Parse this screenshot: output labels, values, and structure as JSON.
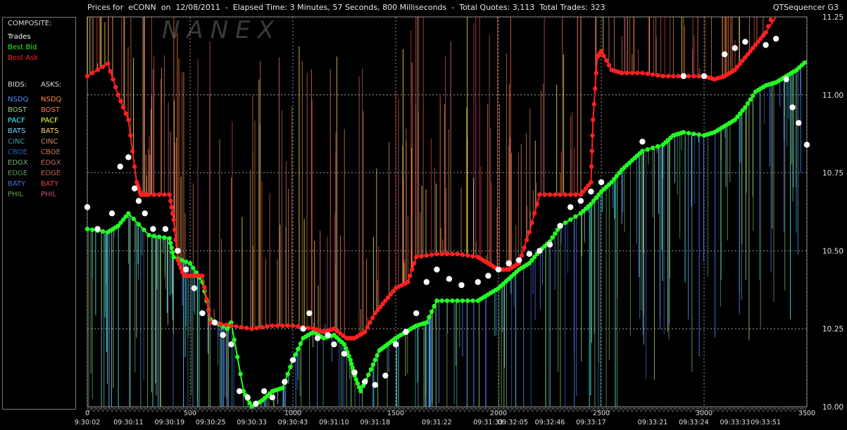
{
  "header": {
    "title": "Prices for  eCONN  on  12/08/2011  -  Elapsed Time: 3 Minutes, 57 Seconds, 800 Milliseconds  -  Total Quotes: 3,113  Total Trades: 323",
    "app_name": "QTSequencer G3",
    "watermark": "NANEX"
  },
  "sidebar": {
    "composite_label": "COMPOSITE:",
    "composite": [
      {
        "label": "Trades",
        "color": "#ffffff"
      },
      {
        "label": "Best Bid",
        "color": "#22ff22"
      },
      {
        "label": "Best Ask",
        "color": "#ff2020"
      }
    ],
    "bids_label": "BIDS:",
    "asks_label": "ASKS:",
    "exchanges": [
      {
        "bid": "NSDQ",
        "ask": "NSDQ",
        "bid_color": "#4f8fff",
        "ask_color": "#ff8a3a"
      },
      {
        "bid": "BOST",
        "ask": "BOST",
        "bid_color": "#a0d080",
        "ask_color": "#ff7a55"
      },
      {
        "bid": "PACF",
        "ask": "PACF",
        "bid_color": "#40ffff",
        "ask_color": "#ffff40"
      },
      {
        "bid": "BATS",
        "ask": "BATS",
        "bid_color": "#7fd0ff",
        "ask_color": "#ffd27a"
      },
      {
        "bid": "CINC",
        "ask": "CINC",
        "bid_color": "#3fa0a0",
        "ask_color": "#d08a6a"
      },
      {
        "bid": "CBOE",
        "ask": "CBOE",
        "bid_color": "#2a60c0",
        "ask_color": "#c87a40"
      },
      {
        "bid": "EDGX",
        "ask": "EDGX",
        "bid_color": "#70b070",
        "ask_color": "#c06a60"
      },
      {
        "bid": "EDGE",
        "ask": "EDGE",
        "bid_color": "#5a9a5a",
        "ask_color": "#c06050"
      },
      {
        "bid": "BATY",
        "ask": "BATY",
        "bid_color": "#4a70e0",
        "ask_color": "#e04040"
      },
      {
        "bid": "PHIL",
        "ask": "PHIL",
        "bid_color": "#70a050",
        "ask_color": "#c05070"
      }
    ]
  },
  "chart_data": {
    "type": "line",
    "xlim": [
      0,
      3500
    ],
    "ylim": [
      10.0,
      11.25
    ],
    "y_ticks": [
      "10.00",
      "10.25",
      "10.50",
      "10.75",
      "11.00",
      "11.25"
    ],
    "x_ticks": [
      "0",
      "500",
      "1000",
      "1500",
      "2000",
      "2500",
      "3000",
      "3500"
    ],
    "time_labels": [
      {
        "x": 0,
        "label": "9:30:02"
      },
      {
        "x": 200,
        "label": "09:30:11"
      },
      {
        "x": 400,
        "label": "09:30:19"
      },
      {
        "x": 600,
        "label": "09:30:25"
      },
      {
        "x": 800,
        "label": "09:30:33"
      },
      {
        "x": 1000,
        "label": "09:30:43"
      },
      {
        "x": 1200,
        "label": "09:31:10"
      },
      {
        "x": 1400,
        "label": "09:31:18"
      },
      {
        "x": 1700,
        "label": "09:31:22"
      },
      {
        "x": 1950,
        "label": "09:31:33"
      },
      {
        "x": 2070,
        "label": "09:32:05"
      },
      {
        "x": 2250,
        "label": "09:32:46"
      },
      {
        "x": 2450,
        "label": "09:33:17"
      },
      {
        "x": 2750,
        "label": "09:33:21"
      },
      {
        "x": 2950,
        "label": "09:33:24"
      },
      {
        "x": 3150,
        "label": "09:33:33"
      },
      {
        "x": 3300,
        "label": "09:33:51"
      }
    ],
    "grid": true,
    "series": [
      {
        "name": "Best Bid",
        "color": "#22ff22",
        "points": [
          [
            0,
            10.57
          ],
          [
            100,
            10.56
          ],
          [
            150,
            10.58
          ],
          [
            200,
            10.62
          ],
          [
            300,
            10.55
          ],
          [
            400,
            10.54
          ],
          [
            420,
            10.48
          ],
          [
            500,
            10.46
          ],
          [
            560,
            10.4
          ],
          [
            600,
            10.28
          ],
          [
            680,
            10.25
          ],
          [
            700,
            10.27
          ],
          [
            760,
            10.05
          ],
          [
            800,
            10.0
          ],
          [
            850,
            10.02
          ],
          [
            900,
            10.05
          ],
          [
            950,
            10.06
          ],
          [
            1000,
            10.15
          ],
          [
            1050,
            10.22
          ],
          [
            1100,
            10.24
          ],
          [
            1150,
            10.22
          ],
          [
            1200,
            10.23
          ],
          [
            1250,
            10.2
          ],
          [
            1280,
            10.15
          ],
          [
            1300,
            10.1
          ],
          [
            1330,
            10.05
          ],
          [
            1380,
            10.12
          ],
          [
            1420,
            10.18
          ],
          [
            1460,
            10.2
          ],
          [
            1500,
            10.22
          ],
          [
            1550,
            10.24
          ],
          [
            1600,
            10.26
          ],
          [
            1650,
            10.27
          ],
          [
            1700,
            10.34
          ],
          [
            1800,
            10.34
          ],
          [
            1900,
            10.34
          ],
          [
            1950,
            10.36
          ],
          [
            2000,
            10.38
          ],
          [
            2050,
            10.41
          ],
          [
            2100,
            10.44
          ],
          [
            2150,
            10.46
          ],
          [
            2200,
            10.5
          ],
          [
            2250,
            10.53
          ],
          [
            2300,
            10.58
          ],
          [
            2400,
            10.62
          ],
          [
            2450,
            10.65
          ],
          [
            2500,
            10.69
          ],
          [
            2550,
            10.72
          ],
          [
            2600,
            10.76
          ],
          [
            2650,
            10.79
          ],
          [
            2700,
            10.82
          ],
          [
            2800,
            10.84
          ],
          [
            2850,
            10.87
          ],
          [
            2900,
            10.88
          ],
          [
            3000,
            10.87
          ],
          [
            3050,
            10.88
          ],
          [
            3100,
            10.9
          ],
          [
            3150,
            10.92
          ],
          [
            3200,
            10.96
          ],
          [
            3250,
            11.01
          ],
          [
            3300,
            11.03
          ],
          [
            3350,
            11.04
          ],
          [
            3400,
            11.06
          ],
          [
            3450,
            11.08
          ],
          [
            3500,
            11.11
          ]
        ]
      },
      {
        "name": "Best Ask",
        "color": "#ff2020",
        "points": [
          [
            0,
            11.06
          ],
          [
            100,
            11.1
          ],
          [
            150,
            11.0
          ],
          [
            200,
            10.92
          ],
          [
            240,
            10.72
          ],
          [
            260,
            10.68
          ],
          [
            300,
            10.68
          ],
          [
            400,
            10.68
          ],
          [
            420,
            10.6
          ],
          [
            440,
            10.47
          ],
          [
            470,
            10.42
          ],
          [
            500,
            10.42
          ],
          [
            560,
            10.42
          ],
          [
            600,
            10.27
          ],
          [
            700,
            10.26
          ],
          [
            800,
            10.25
          ],
          [
            900,
            10.26
          ],
          [
            1000,
            10.26
          ],
          [
            1100,
            10.25
          ],
          [
            1150,
            10.24
          ],
          [
            1200,
            10.25
          ],
          [
            1260,
            10.22
          ],
          [
            1300,
            10.22
          ],
          [
            1350,
            10.24
          ],
          [
            1400,
            10.3
          ],
          [
            1450,
            10.34
          ],
          [
            1500,
            10.38
          ],
          [
            1560,
            10.4
          ],
          [
            1600,
            10.48
          ],
          [
            1700,
            10.49
          ],
          [
            1800,
            10.49
          ],
          [
            1900,
            10.48
          ],
          [
            1950,
            10.46
          ],
          [
            2000,
            10.44
          ],
          [
            2050,
            10.44
          ],
          [
            2100,
            10.46
          ],
          [
            2150,
            10.56
          ],
          [
            2200,
            10.68
          ],
          [
            2300,
            10.68
          ],
          [
            2400,
            10.68
          ],
          [
            2450,
            10.72
          ],
          [
            2460,
            10.92
          ],
          [
            2480,
            11.12
          ],
          [
            2500,
            11.14
          ],
          [
            2550,
            11.08
          ],
          [
            2600,
            11.07
          ],
          [
            2700,
            11.07
          ],
          [
            2800,
            11.06
          ],
          [
            2900,
            11.06
          ],
          [
            3000,
            11.06
          ],
          [
            3050,
            11.05
          ],
          [
            3100,
            11.06
          ],
          [
            3150,
            11.08
          ],
          [
            3200,
            11.12
          ],
          [
            3250,
            11.16
          ],
          [
            3300,
            11.2
          ],
          [
            3350,
            11.28
          ]
        ]
      }
    ],
    "trades": [
      [
        0,
        10.64
      ],
      [
        50,
        10.57
      ],
      [
        120,
        10.62
      ],
      [
        160,
        10.77
      ],
      [
        200,
        10.8
      ],
      [
        230,
        10.7
      ],
      [
        250,
        10.66
      ],
      [
        280,
        10.62
      ],
      [
        320,
        10.57
      ],
      [
        380,
        10.57
      ],
      [
        440,
        10.5
      ],
      [
        480,
        10.44
      ],
      [
        520,
        10.38
      ],
      [
        560,
        10.3
      ],
      [
        620,
        10.27
      ],
      [
        660,
        10.23
      ],
      [
        700,
        10.2
      ],
      [
        740,
        10.05
      ],
      [
        780,
        10.03
      ],
      [
        820,
        10.01
      ],
      [
        860,
        10.05
      ],
      [
        900,
        10.03
      ],
      [
        960,
        10.08
      ],
      [
        1000,
        10.15
      ],
      [
        1050,
        10.25
      ],
      [
        1080,
        10.3
      ],
      [
        1120,
        10.22
      ],
      [
        1170,
        10.23
      ],
      [
        1200,
        10.2
      ],
      [
        1250,
        10.17
      ],
      [
        1300,
        10.11
      ],
      [
        1350,
        10.08
      ],
      [
        1400,
        10.07
      ],
      [
        1450,
        10.1
      ],
      [
        1500,
        10.2
      ],
      [
        1550,
        10.24
      ],
      [
        1600,
        10.3
      ],
      [
        1650,
        10.4
      ],
      [
        1700,
        10.44
      ],
      [
        1760,
        10.41
      ],
      [
        1820,
        10.39
      ],
      [
        1900,
        10.4
      ],
      [
        1950,
        10.42
      ],
      [
        2000,
        10.44
      ],
      [
        2050,
        10.46
      ],
      [
        2100,
        10.47
      ],
      [
        2150,
        10.49
      ],
      [
        2200,
        10.5
      ],
      [
        2250,
        10.52
      ],
      [
        2300,
        10.58
      ],
      [
        2350,
        10.64
      ],
      [
        2400,
        10.66
      ],
      [
        2450,
        10.69
      ],
      [
        2500,
        10.72
      ],
      [
        2700,
        10.85
      ],
      [
        2900,
        11.06
      ],
      [
        3000,
        11.06
      ],
      [
        3100,
        11.13
      ],
      [
        3150,
        11.15
      ],
      [
        3200,
        11.17
      ],
      [
        3300,
        11.16
      ],
      [
        3350,
        11.18
      ],
      [
        3400,
        11.05
      ],
      [
        3430,
        10.96
      ],
      [
        3460,
        10.91
      ],
      [
        3500,
        10.84
      ]
    ]
  }
}
